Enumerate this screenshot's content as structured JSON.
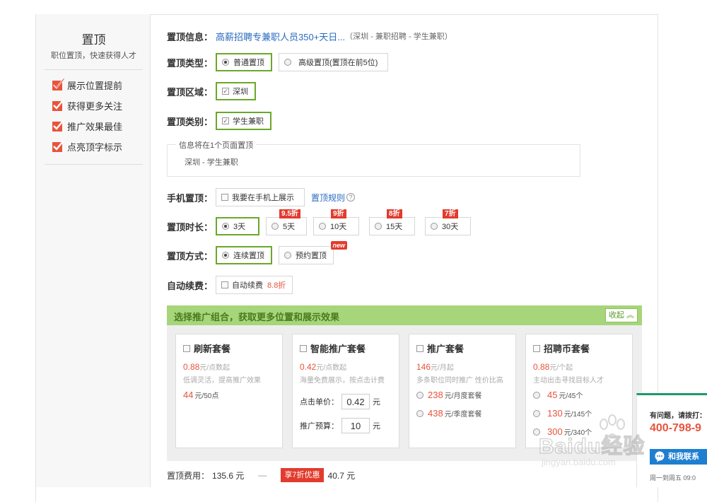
{
  "sidebar": {
    "title": "置顶",
    "subtitle": "职位置顶，快速获得人才",
    "features": [
      "展示位置提前",
      "获得更多关注",
      "推广效果最佳",
      "点亮顶字标示"
    ]
  },
  "info": {
    "label": "置顶信息：",
    "job_link": "高薪招聘专兼职人员350+天日...",
    "job_meta": "（深圳 - 兼职招聘 - 学生兼职）"
  },
  "type": {
    "label": "置顶类型：",
    "options": [
      "普通置顶",
      "高级置顶(置顶在前5位)"
    ],
    "selected": 0
  },
  "region": {
    "label": "置顶区域：",
    "value": "深圳"
  },
  "category": {
    "label": "置顶类别：",
    "value": "学生兼职"
  },
  "infobox": {
    "legend": "信息将在1个页面置顶",
    "text": "深圳 - 学生兼职"
  },
  "mobile": {
    "label": "手机置顶：",
    "option": "我要在手机上展示",
    "rules_link": "置顶规则",
    "help": "?"
  },
  "duration": {
    "label": "置顶时长：",
    "options": [
      {
        "label": "3天",
        "discount": ""
      },
      {
        "label": "5天",
        "discount": "9.5折"
      },
      {
        "label": "10天",
        "discount": "9折"
      },
      {
        "label": "15天",
        "discount": "8折"
      },
      {
        "label": "30天",
        "discount": "7折"
      }
    ],
    "selected": 0
  },
  "method": {
    "label": "置顶方式：",
    "options": [
      "连续置顶",
      "预约置顶"
    ],
    "new_tag": "new",
    "selected": 0
  },
  "renew": {
    "label": "自动续费：",
    "option": "自动续费",
    "discount": "8.8折"
  },
  "promo": {
    "title": "选择推广组合，获取更多位置和展示效果",
    "collapse_label": "收起",
    "cards": [
      {
        "title": "刷新套餐",
        "price": "0.88",
        "unit": "元/点数起",
        "desc": "低调灵活，提高推广效果",
        "line": "44",
        "line_unit": "元/50点"
      },
      {
        "title": "智能推广套餐",
        "price": "0.42",
        "unit": "元/点数起",
        "desc": "海量免费展示，按点击计费",
        "bid_label": "点击单价：",
        "bid_value": "0.42",
        "bid_unit": "元",
        "budget_label": "推广预算：",
        "budget_value": "10",
        "budget_unit": "元"
      },
      {
        "title": "推广套餐",
        "price": "146",
        "unit": "元/月起",
        "desc": "多条职位同时推广 性价比高",
        "plans": [
          {
            "price": "238",
            "unit": "元/月度套餐"
          },
          {
            "price": "438",
            "unit": "元/季度套餐"
          }
        ]
      },
      {
        "title": "招聘币套餐",
        "price": "0.88",
        "unit": "元/个起",
        "desc": "主动出击寻找目标人才",
        "plans": [
          {
            "price": "45",
            "unit": "元/45个"
          },
          {
            "price": "130",
            "unit": "元/145个"
          },
          {
            "price": "300",
            "unit": "元/340个"
          }
        ]
      }
    ]
  },
  "fee": {
    "label": "置顶费用：",
    "original": "135.6 元",
    "dash": "—",
    "tag": "享7折优惠",
    "final": "40.7 元"
  },
  "support": {
    "question": "有问题，请拨打：",
    "phone": "400-798-9",
    "chat_label": "和我联系",
    "hours": "周一到周五 09:0"
  },
  "watermark": {
    "brand": "Baidu经验",
    "url": "jingyan.baidu.com"
  },
  "colors": {
    "green_border": "#6aa82a",
    "promo_header": "#a6d57a",
    "accent_red": "#e23b2e",
    "link_blue": "#2a6bc0"
  }
}
